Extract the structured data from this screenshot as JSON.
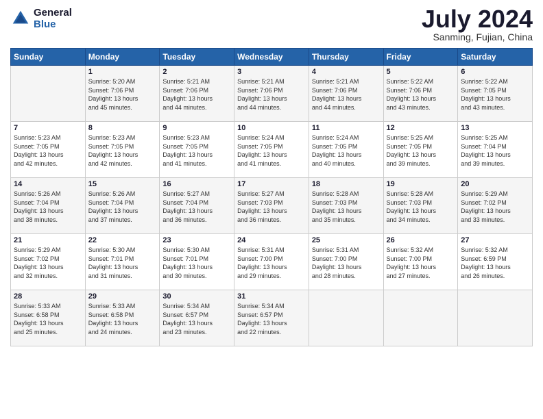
{
  "logo": {
    "text_general": "General",
    "text_blue": "Blue"
  },
  "title": "July 2024",
  "subtitle": "Sanming, Fujian, China",
  "days_of_week": [
    "Sunday",
    "Monday",
    "Tuesday",
    "Wednesday",
    "Thursday",
    "Friday",
    "Saturday"
  ],
  "weeks": [
    [
      {
        "day": "",
        "info": ""
      },
      {
        "day": "1",
        "info": "Sunrise: 5:20 AM\nSunset: 7:06 PM\nDaylight: 13 hours\nand 45 minutes."
      },
      {
        "day": "2",
        "info": "Sunrise: 5:21 AM\nSunset: 7:06 PM\nDaylight: 13 hours\nand 44 minutes."
      },
      {
        "day": "3",
        "info": "Sunrise: 5:21 AM\nSunset: 7:06 PM\nDaylight: 13 hours\nand 44 minutes."
      },
      {
        "day": "4",
        "info": "Sunrise: 5:21 AM\nSunset: 7:06 PM\nDaylight: 13 hours\nand 44 minutes."
      },
      {
        "day": "5",
        "info": "Sunrise: 5:22 AM\nSunset: 7:06 PM\nDaylight: 13 hours\nand 43 minutes."
      },
      {
        "day": "6",
        "info": "Sunrise: 5:22 AM\nSunset: 7:05 PM\nDaylight: 13 hours\nand 43 minutes."
      }
    ],
    [
      {
        "day": "7",
        "info": "Sunrise: 5:23 AM\nSunset: 7:05 PM\nDaylight: 13 hours\nand 42 minutes."
      },
      {
        "day": "8",
        "info": "Sunrise: 5:23 AM\nSunset: 7:05 PM\nDaylight: 13 hours\nand 42 minutes."
      },
      {
        "day": "9",
        "info": "Sunrise: 5:23 AM\nSunset: 7:05 PM\nDaylight: 13 hours\nand 41 minutes."
      },
      {
        "day": "10",
        "info": "Sunrise: 5:24 AM\nSunset: 7:05 PM\nDaylight: 13 hours\nand 41 minutes."
      },
      {
        "day": "11",
        "info": "Sunrise: 5:24 AM\nSunset: 7:05 PM\nDaylight: 13 hours\nand 40 minutes."
      },
      {
        "day": "12",
        "info": "Sunrise: 5:25 AM\nSunset: 7:05 PM\nDaylight: 13 hours\nand 39 minutes."
      },
      {
        "day": "13",
        "info": "Sunrise: 5:25 AM\nSunset: 7:04 PM\nDaylight: 13 hours\nand 39 minutes."
      }
    ],
    [
      {
        "day": "14",
        "info": "Sunrise: 5:26 AM\nSunset: 7:04 PM\nDaylight: 13 hours\nand 38 minutes."
      },
      {
        "day": "15",
        "info": "Sunrise: 5:26 AM\nSunset: 7:04 PM\nDaylight: 13 hours\nand 37 minutes."
      },
      {
        "day": "16",
        "info": "Sunrise: 5:27 AM\nSunset: 7:04 PM\nDaylight: 13 hours\nand 36 minutes."
      },
      {
        "day": "17",
        "info": "Sunrise: 5:27 AM\nSunset: 7:03 PM\nDaylight: 13 hours\nand 36 minutes."
      },
      {
        "day": "18",
        "info": "Sunrise: 5:28 AM\nSunset: 7:03 PM\nDaylight: 13 hours\nand 35 minutes."
      },
      {
        "day": "19",
        "info": "Sunrise: 5:28 AM\nSunset: 7:03 PM\nDaylight: 13 hours\nand 34 minutes."
      },
      {
        "day": "20",
        "info": "Sunrise: 5:29 AM\nSunset: 7:02 PM\nDaylight: 13 hours\nand 33 minutes."
      }
    ],
    [
      {
        "day": "21",
        "info": "Sunrise: 5:29 AM\nSunset: 7:02 PM\nDaylight: 13 hours\nand 32 minutes."
      },
      {
        "day": "22",
        "info": "Sunrise: 5:30 AM\nSunset: 7:01 PM\nDaylight: 13 hours\nand 31 minutes."
      },
      {
        "day": "23",
        "info": "Sunrise: 5:30 AM\nSunset: 7:01 PM\nDaylight: 13 hours\nand 30 minutes."
      },
      {
        "day": "24",
        "info": "Sunrise: 5:31 AM\nSunset: 7:00 PM\nDaylight: 13 hours\nand 29 minutes."
      },
      {
        "day": "25",
        "info": "Sunrise: 5:31 AM\nSunset: 7:00 PM\nDaylight: 13 hours\nand 28 minutes."
      },
      {
        "day": "26",
        "info": "Sunrise: 5:32 AM\nSunset: 7:00 PM\nDaylight: 13 hours\nand 27 minutes."
      },
      {
        "day": "27",
        "info": "Sunrise: 5:32 AM\nSunset: 6:59 PM\nDaylight: 13 hours\nand 26 minutes."
      }
    ],
    [
      {
        "day": "28",
        "info": "Sunrise: 5:33 AM\nSunset: 6:58 PM\nDaylight: 13 hours\nand 25 minutes."
      },
      {
        "day": "29",
        "info": "Sunrise: 5:33 AM\nSunset: 6:58 PM\nDaylight: 13 hours\nand 24 minutes."
      },
      {
        "day": "30",
        "info": "Sunrise: 5:34 AM\nSunset: 6:57 PM\nDaylight: 13 hours\nand 23 minutes."
      },
      {
        "day": "31",
        "info": "Sunrise: 5:34 AM\nSunset: 6:57 PM\nDaylight: 13 hours\nand 22 minutes."
      },
      {
        "day": "",
        "info": ""
      },
      {
        "day": "",
        "info": ""
      },
      {
        "day": "",
        "info": ""
      }
    ]
  ]
}
